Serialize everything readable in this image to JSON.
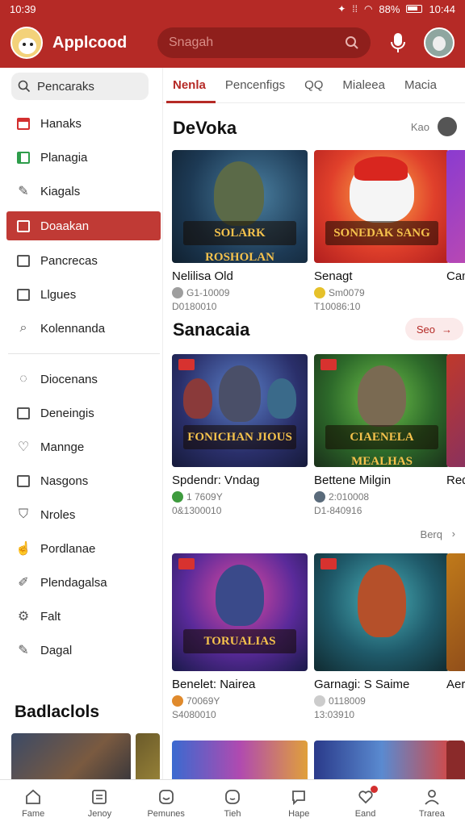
{
  "status_bar": {
    "time": "10:39",
    "battery": "88%",
    "clock_right": "10:44"
  },
  "app": {
    "title": "Applcood"
  },
  "search": {
    "placeholder": "Snagah"
  },
  "sidebar": {
    "search_label": "Pencaraks",
    "items": [
      {
        "label": "Hanaks",
        "icon": "tv-icon"
      },
      {
        "label": "Planagia",
        "icon": "calendar-icon"
      },
      {
        "label": "Kiagals",
        "icon": "brush-icon"
      },
      {
        "label": "Doaakan",
        "icon": "document-icon",
        "active": true
      },
      {
        "label": "Pancrecas",
        "icon": "inbox-icon"
      },
      {
        "label": "Llgues",
        "icon": "list-icon"
      },
      {
        "label": "Kolennanda",
        "icon": "search-icon"
      }
    ],
    "items2": [
      {
        "label": "Diocenans",
        "icon": "chat-icon"
      },
      {
        "label": "Deneingis",
        "icon": "square-icon"
      },
      {
        "label": "Mannge",
        "icon": "heart-icon"
      },
      {
        "label": "Nasgons",
        "icon": "frame-icon"
      },
      {
        "label": "Nroles",
        "icon": "shield-icon"
      },
      {
        "label": "Pordlanae",
        "icon": "hand-icon"
      },
      {
        "label": "Plendagalsa",
        "icon": "pen-icon"
      },
      {
        "label": "Falt",
        "icon": "gear-icon"
      },
      {
        "label": "Dagal",
        "icon": "edit-icon"
      }
    ],
    "section_title": "Badlaclols"
  },
  "tabs": [
    "Nenla",
    "Pencenfigs",
    "QQ",
    "Mialeea",
    "Macia"
  ],
  "sections": [
    {
      "title": "DeVoka",
      "right_text": "Kao",
      "cards": [
        {
          "art_title": "SOLARK ROSHOLAN",
          "name": "Nelilisa Old",
          "meta": "G1-10009",
          "meta2": "D0180010",
          "dot": "#9e9e9e"
        },
        {
          "art_title": "SONEDAK SANG",
          "name": "Senagt",
          "meta": "Sm0079",
          "meta2": "T10086:10",
          "dot": "#e6c12a"
        },
        {
          "name": "Cam",
          "meta": "",
          "meta2": ""
        }
      ]
    },
    {
      "title": "Sanacaia",
      "see_label": "Seo",
      "cards": [
        {
          "art_title": "FONICHAN JIOUS",
          "name": "Spdendr: Vndag",
          "meta": "1 7609Y",
          "meta2": "0&1300010",
          "dot": "#3e9b3e"
        },
        {
          "art_title": "CIAENELA MEALHAS",
          "name": "Bettene Milgin",
          "meta": "2:010008",
          "meta2": "D1-840916",
          "dot": "#5a6b7b"
        },
        {
          "name": "Red",
          "meta": "",
          "meta2": ""
        }
      ],
      "more_label": "Berq"
    },
    {
      "cards": [
        {
          "art_title": "TORUALIAS",
          "name": "Benelet: Nairea",
          "meta": "70069Y",
          "meta2": "S4080010",
          "dot": "#e08a2c"
        },
        {
          "art_title": "",
          "name": "Garnagi: S Saime",
          "meta": "0118009",
          "meta2": "13:03910",
          "dot": "#cccccc"
        },
        {
          "name": "Aer",
          "meta": "",
          "meta2": ""
        }
      ]
    }
  ],
  "bottom_nav": [
    {
      "label": "Fame",
      "icon": "home-icon"
    },
    {
      "label": "Jenoy",
      "icon": "grid-icon"
    },
    {
      "label": "Pemunes",
      "icon": "smile-icon"
    },
    {
      "label": "Tieh",
      "icon": "face-icon"
    },
    {
      "label": "Hape",
      "icon": "chat-bubble-icon"
    },
    {
      "label": "Eand",
      "icon": "heart-icon",
      "badge": true
    },
    {
      "label": "Trarea",
      "icon": "person-icon"
    }
  ],
  "colors": {
    "brand": "#b52a26",
    "active_item": "#c03a35"
  }
}
